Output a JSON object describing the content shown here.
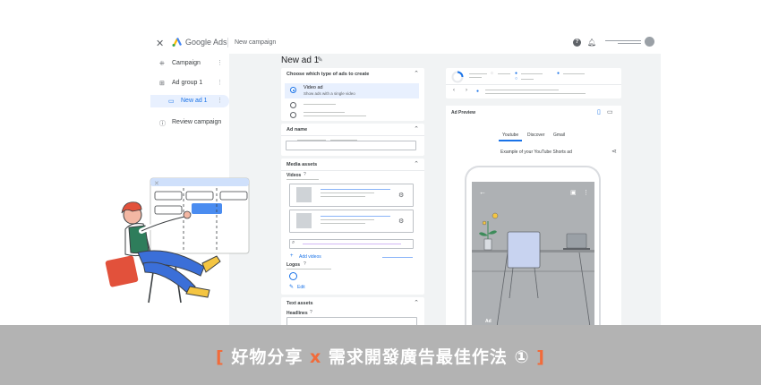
{
  "app": {
    "logo_text": "Google Ads",
    "breadcrumb": "New campaign",
    "close_icon": "close-icon",
    "help_icon": "?"
  },
  "nav": {
    "items": [
      {
        "icon": "⁜",
        "label": "Campaign"
      },
      {
        "icon": "⊞",
        "label": "Ad group 1"
      },
      {
        "icon": "▭",
        "label": "New ad 1"
      },
      {
        "icon": "ⓘ",
        "label": "Review campaign"
      }
    ]
  },
  "editor": {
    "ad_title": "New ad 1",
    "type_card": {
      "header": "Choose which type of ads to create",
      "selected_title": "Video ad",
      "selected_sub": "Show ads with a single video"
    },
    "ad_name_header": "Ad name",
    "media": {
      "header": "Media assets",
      "videos_label": "Videos",
      "add_videos": "Add videos",
      "logos_label": "Logos",
      "edit": "Edit"
    },
    "text_assets": {
      "header": "Text assets",
      "headlines_label": "Headlines"
    }
  },
  "preview": {
    "header": "Ad Preview",
    "tabs": [
      "Youtube",
      "Discover",
      "Gmail"
    ],
    "caption": "Example of your YouTube Shorts ad",
    "ad_tag": "Ad"
  },
  "banner": {
    "open": "[",
    "part1": "好物分享",
    "x": "x",
    "part2": "需求開發廣告最佳作法",
    "num": "①",
    "close": "]"
  },
  "colors": {
    "accent": "#1a73e8",
    "banner_bg": "#b3b3b3",
    "banner_orange": "#f26b3a",
    "character_shirt": "#2e7d5b",
    "character_pants": "#3b6fd8",
    "character_hair": "#e2513b",
    "character_shoes": "#f4c542"
  }
}
